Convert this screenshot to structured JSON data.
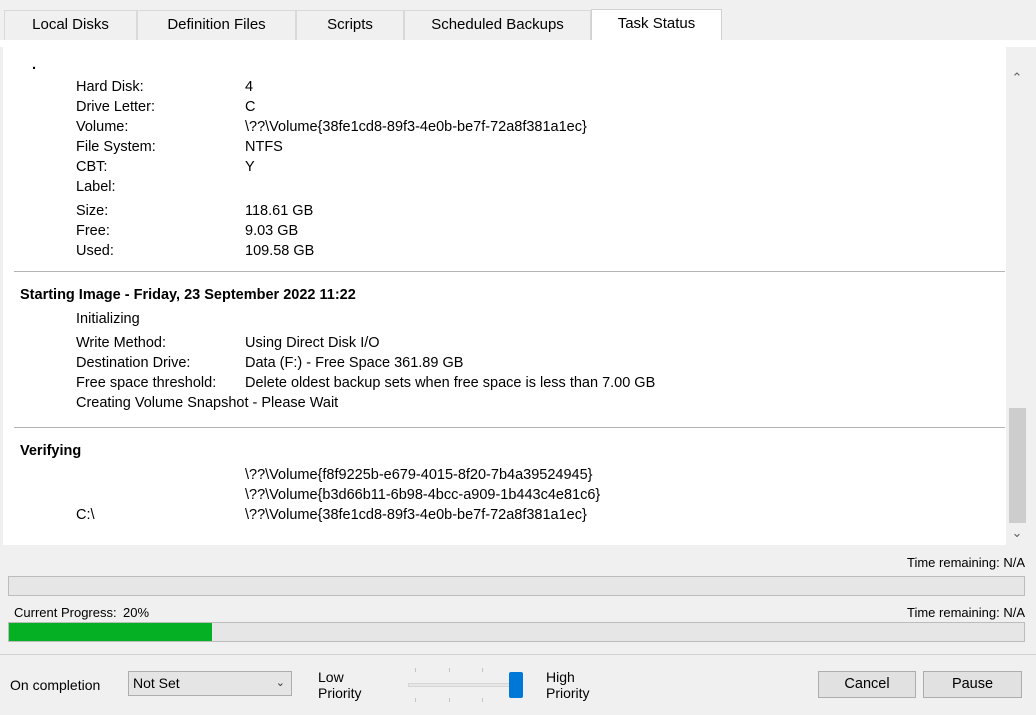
{
  "tabs": [
    "Local Disks",
    "Definition Files",
    "Scripts",
    "Scheduled Backups",
    "Task Status"
  ],
  "disk": {
    "bullet": ".",
    "labels": [
      "Hard Disk:",
      "Drive Letter:",
      "Volume:",
      "File System:",
      "CBT:",
      "Label:",
      "Size:",
      "Free:",
      "Used:"
    ],
    "values": [
      "4",
      "C",
      "\\??\\Volume{38fe1cd8-89f3-4e0b-be7f-72a8f381a1ec}",
      "NTFS",
      "Y",
      "",
      "118.61 GB",
      "9.03 GB",
      "109.58 GB"
    ]
  },
  "imaging": {
    "header": "Starting Image - Friday, 23 September 2022 11:22",
    "status": "Initializing",
    "labels": [
      "Write Method:",
      "Destination Drive:",
      "Free space threshold:"
    ],
    "values": [
      "Using Direct Disk I/O",
      "Data (F:) - Free Space 361.89 GB",
      "Delete oldest backup sets when free space is less than 7.00 GB"
    ],
    "snapshot": "Creating Volume Snapshot - Please Wait"
  },
  "verifying": {
    "header": "Verifying",
    "volumes": [
      {
        "drive": "",
        "volume": "\\??\\Volume{f8f9225b-e679-4015-8f20-7b4a39524945}"
      },
      {
        "drive": "",
        "volume": "\\??\\Volume{b3d66b11-6b98-4bcc-a909-1b443c4e81c6}"
      },
      {
        "drive": "C:\\",
        "volume": "\\??\\Volume{38fe1cd8-89f3-4e0b-be7f-72a8f381a1ec}"
      }
    ]
  },
  "progress": {
    "overall_time_remaining": "Time remaining: N/A",
    "overall_fraction": 0,
    "current_label": "Current Progress:",
    "current_percent_text": "20%",
    "current_fraction": 0.2,
    "current_time_remaining": "Time remaining: N/A",
    "fill_color": "#06b025"
  },
  "footer": {
    "on_completion_label": "On completion",
    "on_completion_value": "Not Set",
    "low_priority": [
      "Low",
      "Priority"
    ],
    "high_priority": [
      "High",
      "Priority"
    ],
    "priority_level": 1.0,
    "cancel": "Cancel",
    "pause": "Pause"
  },
  "icons": {
    "scroll_up": "chevron-up-icon",
    "scroll_down": "chevron-down-icon",
    "dropdown": "chevron-down-icon"
  },
  "colors": {
    "accent": "#0078d7",
    "progress": "#06b025"
  }
}
